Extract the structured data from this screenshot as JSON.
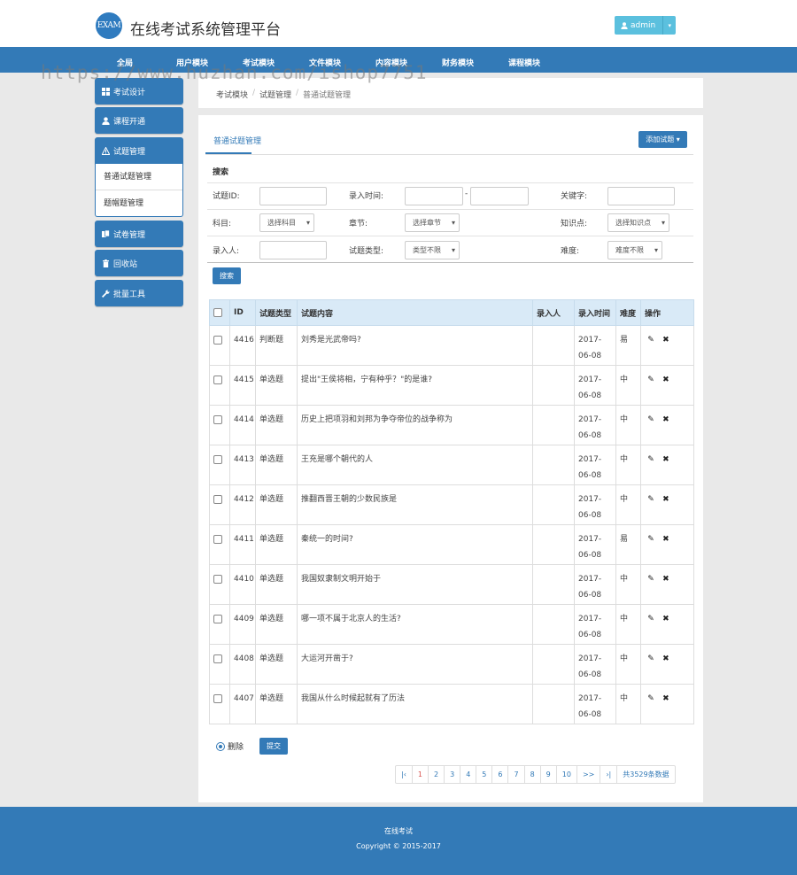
{
  "brand": {
    "logo_text": "EXAM",
    "title": "在线考试系统管理平台"
  },
  "user_menu": {
    "label": "admin"
  },
  "main_nav": [
    "全局",
    "用户模块",
    "考试模块",
    "文件模块",
    "内容模块",
    "财务模块",
    "课程模块"
  ],
  "watermark": "https://www.huzhan.com/ishop7751",
  "sidebar": {
    "items": [
      "考试设计",
      "课程开通",
      "试题管理",
      "试卷管理",
      "回收站",
      "批量工具"
    ],
    "subitems": [
      "普通试题管理",
      "题帽题管理"
    ]
  },
  "breadcrumb": [
    "考试模块",
    "试题管理",
    "普通试题管理"
  ],
  "panel": {
    "tab_title": "普通试题管理",
    "add_button": "添加试题"
  },
  "search": {
    "title": "搜索",
    "labels": {
      "id": "试题ID:",
      "time": "录入时间:",
      "time_sep": "-",
      "keyword": "关键字:",
      "subject": "科目:",
      "chapter": "章节:",
      "point": "知识点:",
      "author": "录入人:",
      "qtype": "试题类型:",
      "difficulty": "难度:"
    },
    "selects": {
      "subject": "选择科目",
      "chapter": "选择章节",
      "point": "选择知识点",
      "qtype": "类型不限",
      "difficulty": "难度不限"
    },
    "button": "搜索"
  },
  "table": {
    "headers": [
      "ID",
      "试题类型",
      "试题内容",
      "录入人",
      "录入时间",
      "难度",
      "操作"
    ],
    "rows": [
      {
        "id": "4416",
        "type": "判断题",
        "content": "刘秀是光武帝吗?",
        "author": "",
        "date": "2017-06-08",
        "level": "易"
      },
      {
        "id": "4415",
        "type": "单选题",
        "content": "提出\"王侯将相，宁有种乎？\"的是谁?",
        "author": "",
        "date": "2017-06-08",
        "level": "中"
      },
      {
        "id": "4414",
        "type": "单选题",
        "content": "历史上把项羽和刘邦为争夺帝位的战争称为",
        "author": "",
        "date": "2017-06-08",
        "level": "中"
      },
      {
        "id": "4413",
        "type": "单选题",
        "content": "王充是哪个朝代的人",
        "author": "",
        "date": "2017-06-08",
        "level": "中"
      },
      {
        "id": "4412",
        "type": "单选题",
        "content": "推翻西晋王朝的少数民族是",
        "author": "",
        "date": "2017-06-08",
        "level": "中"
      },
      {
        "id": "4411",
        "type": "单选题",
        "content": "秦统一的时间?",
        "author": "",
        "date": "2017-06-08",
        "level": "易"
      },
      {
        "id": "4410",
        "type": "单选题",
        "content": "我国奴隶制文明开始于",
        "author": "",
        "date": "2017-06-08",
        "level": "中"
      },
      {
        "id": "4409",
        "type": "单选题",
        "content": "哪一项不属于北京人的生活?",
        "author": "",
        "date": "2017-06-08",
        "level": "中"
      },
      {
        "id": "4408",
        "type": "单选题",
        "content": "大运河开凿于?",
        "author": "",
        "date": "2017-06-08",
        "level": "中"
      },
      {
        "id": "4407",
        "type": "单选题",
        "content": "我国从什么时候起就有了历法",
        "author": "",
        "date": "2017-06-08",
        "level": "中"
      }
    ]
  },
  "bulk": {
    "radio_label": "删除",
    "submit": "提交"
  },
  "pagination": {
    "items": [
      "|‹",
      "1",
      "2",
      "3",
      "4",
      "5",
      "6",
      "7",
      "8",
      "9",
      "10",
      ">>",
      "›|"
    ],
    "current": "1",
    "total": "共3529条数据"
  },
  "footer": {
    "line1": "在线考试",
    "line2": "Copyright © 2015-2017"
  },
  "colors": {
    "primary": "#337ab7",
    "info": "#5bc0de",
    "table_header": "#d9eaf7"
  },
  "icons": [
    "user-icon",
    "grid-icon",
    "warning-icon",
    "files-icon",
    "trash-icon",
    "wrench-icon",
    "edit-icon",
    "close-icon"
  ]
}
